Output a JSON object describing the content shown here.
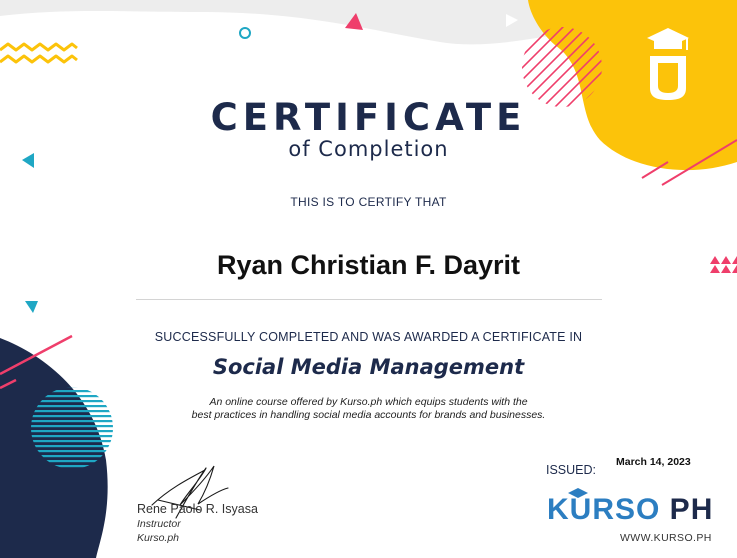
{
  "certificate": {
    "title": "CERTIFICATE",
    "subtitle": "of Completion",
    "certify_text": "THIS IS TO CERTIFY THAT",
    "recipient": "Ryan Christian F. Dayrit",
    "completion_text": "SUCCESSFULLY COMPLETED AND WAS AWARDED A CERTIFICATE IN",
    "course": "Social Media Management",
    "description_line1": "An online course offered by Kurso.ph which equips students with the",
    "description_line2": "best practices in handling social media accounts for brands and businesses."
  },
  "issued": {
    "label": "ISSUED:",
    "date": "March 14, 2023"
  },
  "signatory": {
    "name": "Rene Paolo R. Isyasa",
    "role": "Instructor",
    "organization": "Kurso.ph"
  },
  "brand": {
    "name_part1": "KURSO",
    "name_part2": " PH",
    "url": "WWW.KURSO.PH"
  },
  "colors": {
    "navy": "#1d2a4b",
    "yellow": "#fcc30a",
    "pink": "#ef3e6b",
    "teal": "#1fa7c4",
    "brand_blue": "#2c7ec1"
  }
}
